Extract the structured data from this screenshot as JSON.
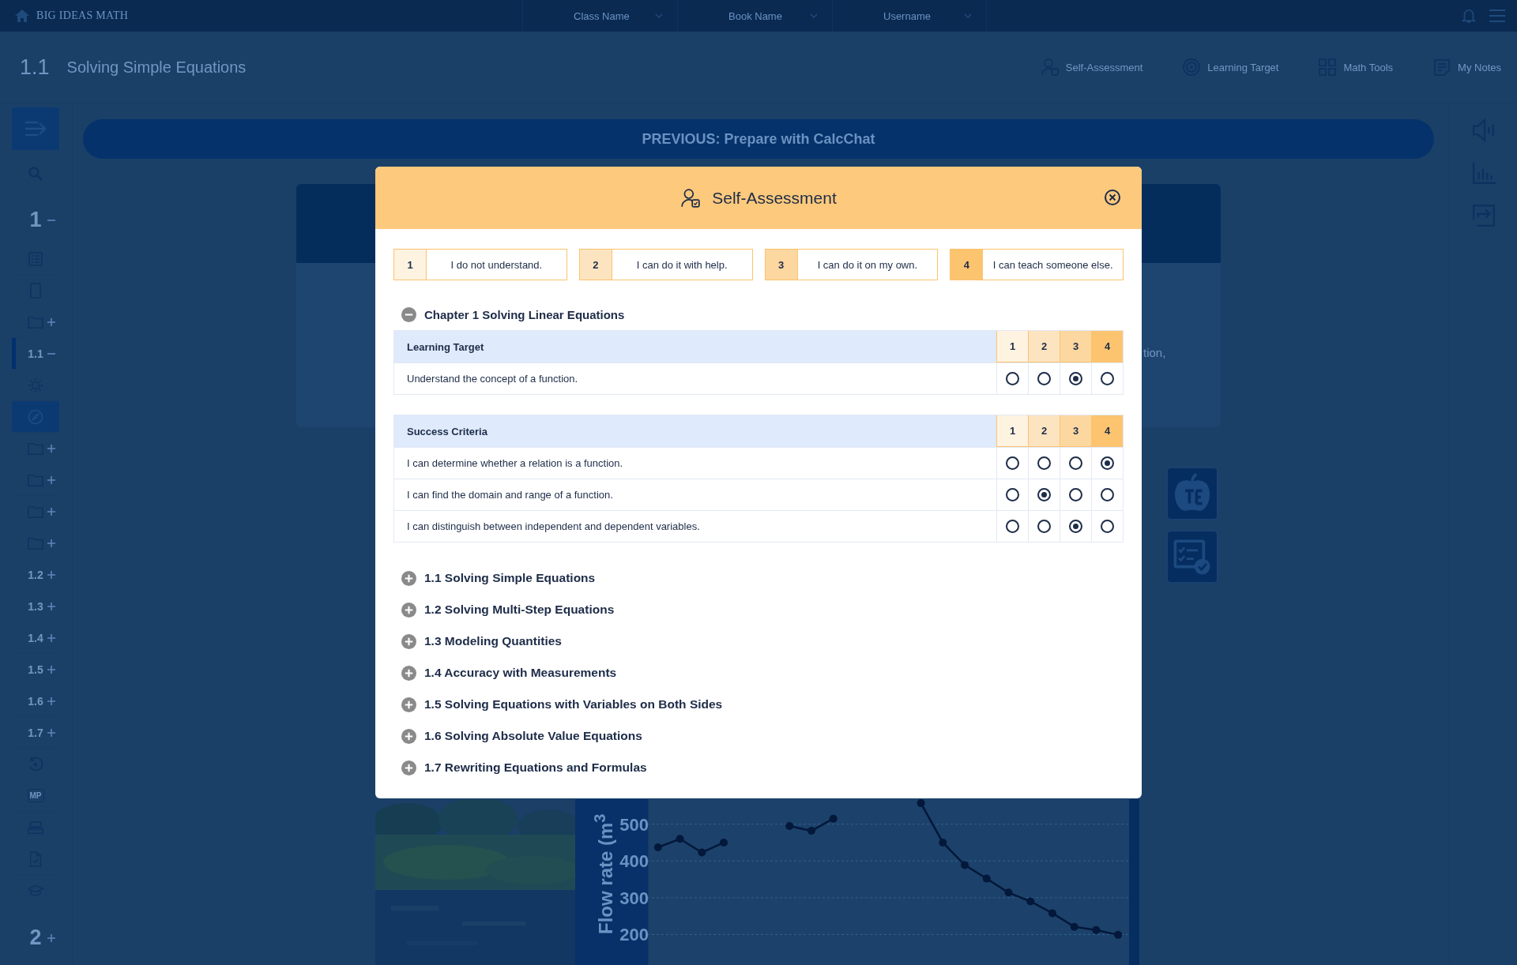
{
  "top_bar": {
    "logo": "BIG IDEAS MATH",
    "dropdowns": [
      "Class Name",
      "Book Name",
      "Username"
    ]
  },
  "header": {
    "number": "1.1",
    "title": "Solving Simple Equations",
    "links": [
      {
        "label": "Self-Assessment",
        "kind": "assessment"
      },
      {
        "label": "Learning Target",
        "kind": "target"
      },
      {
        "label": "Math Tools",
        "kind": "tools"
      },
      {
        "label": "My Notes",
        "kind": "notes"
      }
    ]
  },
  "sidebar": {
    "items": [
      {
        "kind": "search",
        "selected": false,
        "current": false
      },
      {
        "kind": "chapter",
        "label": "1",
        "expanded": true,
        "selected": false,
        "current": false
      },
      {
        "kind": "list",
        "selected": false,
        "current": false
      },
      {
        "kind": "tablet",
        "selected": false,
        "current": false
      },
      {
        "kind": "folder",
        "expanded": false,
        "selected": false,
        "current": false
      },
      {
        "kind": "section",
        "label": "1.1",
        "expanded": true,
        "selected": false,
        "current": true
      },
      {
        "kind": "sun",
        "selected": false,
        "current": false
      },
      {
        "kind": "compass",
        "selected": true,
        "current": false
      },
      {
        "kind": "folder",
        "expanded": false,
        "selected": false,
        "current": false
      },
      {
        "kind": "folder",
        "expanded": false,
        "selected": false,
        "current": false
      },
      {
        "kind": "folder",
        "expanded": false,
        "selected": false,
        "current": false
      },
      {
        "kind": "folder",
        "expanded": false,
        "selected": false,
        "current": false
      },
      {
        "kind": "section",
        "label": "1.2",
        "expanded": false,
        "selected": false,
        "current": false
      },
      {
        "kind": "section",
        "label": "1.3",
        "expanded": false,
        "selected": false,
        "current": false
      },
      {
        "kind": "section",
        "label": "1.4",
        "expanded": false,
        "selected": false,
        "current": false
      },
      {
        "kind": "section",
        "label": "1.5",
        "expanded": false,
        "selected": false,
        "current": false
      },
      {
        "kind": "section",
        "label": "1.6",
        "expanded": false,
        "selected": false,
        "current": false
      },
      {
        "kind": "section",
        "label": "1.7",
        "expanded": false,
        "selected": false,
        "current": false
      },
      {
        "kind": "refresh",
        "selected": false,
        "current": false
      },
      {
        "kind": "badge",
        "label": "MP",
        "selected": false,
        "current": false
      },
      {
        "kind": "tools",
        "selected": false,
        "current": false
      },
      {
        "kind": "doc",
        "selected": false,
        "current": false
      },
      {
        "kind": "cap",
        "selected": false,
        "current": false
      },
      {
        "kind": "chapter",
        "label": "2",
        "expanded": false,
        "selected": false,
        "current": false
      }
    ]
  },
  "previous_button": "PREVIOUS: Prepare with CalcChat",
  "card": {
    "text": "tion,"
  },
  "figure": {
    "chart_data": {
      "type": "line",
      "ylabel": "Flow rate (m$^{3}$",
      "yticks": [
        200,
        300,
        400,
        500
      ],
      "ylim": [
        115,
        568
      ],
      "grid": true,
      "marker": "o",
      "values": [
        437,
        460,
        423,
        450,
        null,
        null,
        495,
        482,
        515,
        null,
        null,
        null,
        557,
        450,
        389,
        352,
        314,
        290,
        258,
        221,
        212,
        199
      ]
    }
  },
  "modal": {
    "title": "Self-Assessment",
    "legend": [
      {
        "number": "1",
        "label": "I do not understand.",
        "color": "#fef3e1"
      },
      {
        "number": "2",
        "label": "I can do it with help.",
        "color": "#fde4c0"
      },
      {
        "number": "3",
        "label": "I can do it on my own.",
        "color": "#fdd7a0"
      },
      {
        "number": "4",
        "label": "I can teach someone else.",
        "color": "#fcc46f"
      }
    ],
    "chapter": {
      "title": "Chapter 1 Solving Linear Equations",
      "expanded": true,
      "tables": [
        {
          "heading": "Learning Target",
          "columns": [
            "1",
            "2",
            "3",
            "4"
          ],
          "rows": [
            {
              "text": "Understand the concept of a function.",
              "choices": [
                {
                  "selected": false
                },
                {
                  "selected": false
                },
                {
                  "selected": true
                },
                {
                  "selected": false
                }
              ]
            }
          ]
        },
        {
          "heading": "Success Criteria",
          "columns": [
            "1",
            "2",
            "3",
            "4"
          ],
          "rows": [
            {
              "text": "I can determine whether a relation is a function.",
              "choices": [
                {
                  "selected": false
                },
                {
                  "selected": false
                },
                {
                  "selected": false
                },
                {
                  "selected": true
                }
              ]
            },
            {
              "text": "I can find the domain and range of a function.",
              "choices": [
                {
                  "selected": false
                },
                {
                  "selected": true
                },
                {
                  "selected": false
                },
                {
                  "selected": false
                }
              ]
            },
            {
              "text": "I can distinguish between independent and dependent variables.",
              "choices": [
                {
                  "selected": false
                },
                {
                  "selected": false
                },
                {
                  "selected": true
                },
                {
                  "selected": false
                }
              ]
            }
          ]
        }
      ]
    },
    "sections": [
      {
        "title": "1.1 Solving Simple Equations",
        "expanded": false
      },
      {
        "title": "1.2 Solving Multi-Step Equations",
        "expanded": false
      },
      {
        "title": "1.3 Modeling Quantities",
        "expanded": false
      },
      {
        "title": "1.4 Accuracy with Measurements",
        "expanded": false
      },
      {
        "title": "1.5 Solving Equations with Variables on Both Sides",
        "expanded": false
      },
      {
        "title": "1.6 Solving Absolute Value Equations",
        "expanded": false
      },
      {
        "title": "1.7 Rewriting Equations and Formulas",
        "expanded": false
      }
    ]
  }
}
